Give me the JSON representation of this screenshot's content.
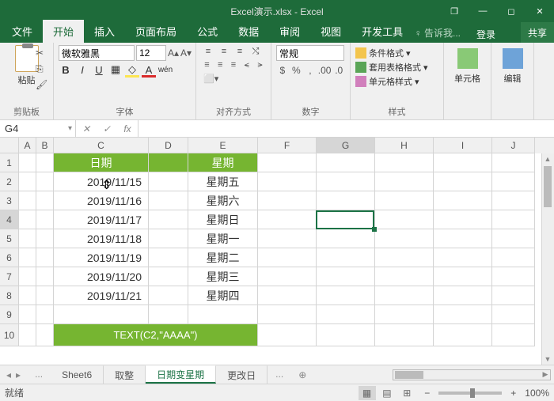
{
  "title": "Excel演示.xlsx - Excel",
  "win": {
    "min": "—",
    "max": "◻",
    "box": "❐",
    "close": "✕"
  },
  "menu": {
    "file": "文件",
    "home": "开始",
    "insert": "插入",
    "layout": "页面布局",
    "formula": "公式",
    "data": "数据",
    "review": "审阅",
    "view": "视图",
    "dev": "开发工具",
    "tell": "♀ 告诉我...",
    "login": "登录",
    "share": "共享"
  },
  "ribbon": {
    "clipboard": {
      "paste": "粘贴",
      "label": "剪贴板"
    },
    "font": {
      "name": "微软雅黑",
      "size": "12",
      "bold": "B",
      "italic": "I",
      "underline": "U",
      "label": "字体"
    },
    "align": {
      "label": "对齐方式"
    },
    "number": {
      "format": "常规",
      "label": "数字"
    },
    "styles": {
      "cond": "条件格式",
      "table": "套用表格格式",
      "cell": "单元格样式",
      "label": "样式"
    },
    "cells": {
      "label": "单元格"
    },
    "edit": {
      "label": "编辑"
    }
  },
  "namebox": "G4",
  "fx_label": "fx",
  "formula_value": "",
  "cols": [
    "A",
    "B",
    "C",
    "D",
    "E",
    "F",
    "G",
    "H",
    "I",
    "J"
  ],
  "rows": [
    "1",
    "2",
    "3",
    "4",
    "5",
    "6",
    "7",
    "8",
    "9",
    "10"
  ],
  "headers": {
    "col_c": "日期",
    "col_e": "星期"
  },
  "dates": [
    "2019/11/15",
    "2019/11/16",
    "2019/11/17",
    "2019/11/18",
    "2019/11/19",
    "2019/11/20",
    "2019/11/21"
  ],
  "weekdays": [
    "星期五",
    "星期六",
    "星期日",
    "星期一",
    "星期二",
    "星期三",
    "星期四"
  ],
  "formula_banner": "TEXT(C2,\"AAAA\")",
  "sheets": {
    "nav_prev": "◂",
    "nav_next": "▸",
    "more": "...",
    "items": [
      "Sheet6",
      "取整",
      "日期变星期",
      "更改日"
    ],
    "add": "⊕"
  },
  "status": {
    "ready": "就绪",
    "zoom": "100%"
  },
  "chart_data": {
    "type": "table",
    "title": "日期变星期",
    "columns": [
      "日期",
      "星期"
    ],
    "rows": [
      [
        "2019/11/15",
        "星期五"
      ],
      [
        "2019/11/16",
        "星期六"
      ],
      [
        "2019/11/17",
        "星期日"
      ],
      [
        "2019/11/18",
        "星期一"
      ],
      [
        "2019/11/19",
        "星期二"
      ],
      [
        "2019/11/20",
        "星期三"
      ],
      [
        "2019/11/21",
        "星期四"
      ]
    ],
    "formula": "TEXT(C2,\"AAAA\")"
  }
}
